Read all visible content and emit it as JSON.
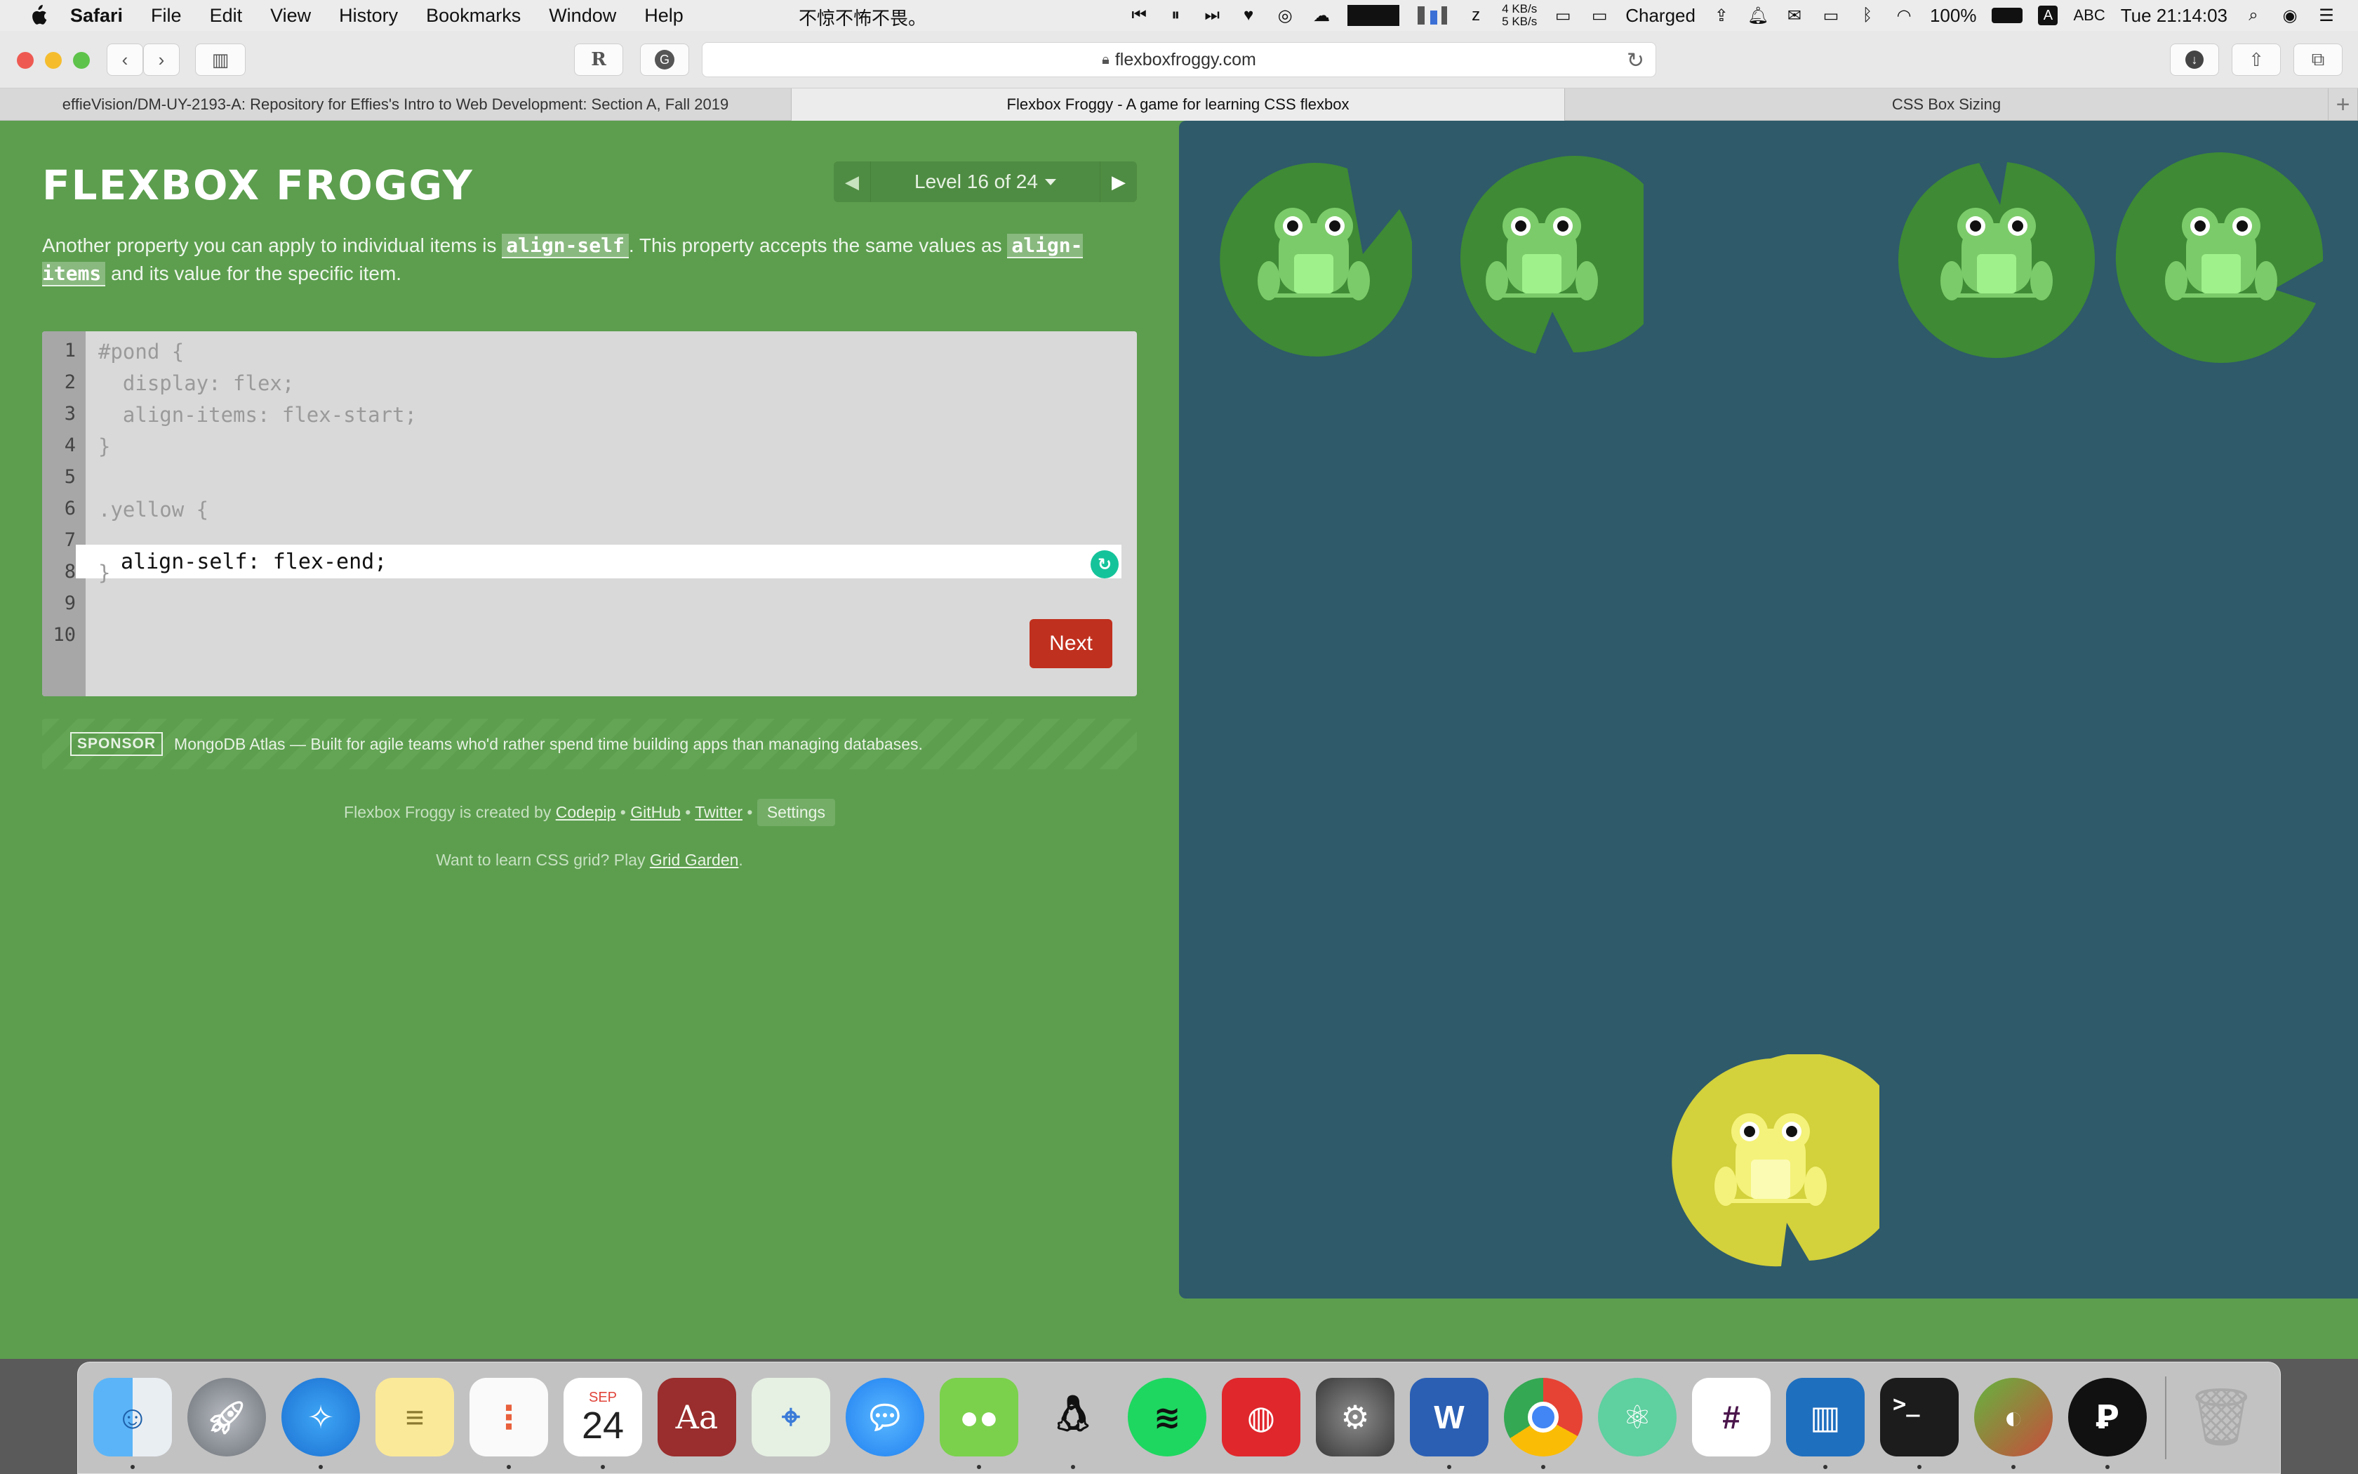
{
  "menubar": {
    "app_name": "Safari",
    "items": [
      "File",
      "Edit",
      "View",
      "History",
      "Bookmarks",
      "Window",
      "Help"
    ],
    "chinese_text": "不惊不怖不畏。",
    "status": {
      "net_up": "4 KB/s",
      "net_down": "5 KB/s",
      "battery_state": "Charged",
      "battery_percent": "100%",
      "input_method": "ABC",
      "clock": "Tue 21:14:03"
    }
  },
  "browser": {
    "url": "flexboxfroggy.com",
    "tabs": [
      {
        "title": "effieVision/DM-UY-2193-A: Repository for Effies's Intro to Web Development: Section A, Fall 2019"
      },
      {
        "title": "Flexbox Froggy - A game for learning CSS flexbox"
      },
      {
        "title": "CSS Box Sizing"
      }
    ]
  },
  "game": {
    "title": "FLEXBOX FROGGY",
    "level_label": "Level 16 of 24",
    "instructions": {
      "part1": "Another property you can apply to individual items is ",
      "code1": "align-self",
      "part2": ". This property accepts the same values as ",
      "code2": "align-items",
      "part3": " and its value for the specific item."
    },
    "code_lines": [
      "#pond {",
      "  display: flex;",
      "  align-items: flex-start;",
      "}",
      "",
      ".yellow {",
      "",
      "}",
      "",
      ""
    ],
    "line_numbers": [
      "1",
      "2",
      "3",
      "4",
      "5",
      "6",
      "7",
      "8",
      "9",
      "10"
    ],
    "answer_value": "align-self: flex-end;",
    "next_label": "Next",
    "sponsor": {
      "badge": "SPONSOR",
      "text": "MongoDB Atlas — Built for agile teams who'd rather spend time building apps than managing databases."
    },
    "credits": {
      "prefix": "Flexbox Froggy is created by ",
      "codepip": "Codepip",
      "github": "GitHub",
      "twitter": "Twitter",
      "settings": "Settings",
      "sep": " • "
    },
    "grid_garden": {
      "prefix": "Want to learn CSS grid? Play ",
      "link": "Grid Garden",
      "suffix": "."
    },
    "colors": {
      "background": "#5c9e4e",
      "pond": "#2e5a6a",
      "green_pad": "#3e8a35",
      "green_frog": "#7ccb6a",
      "yellow_pad": "#d3d13c",
      "yellow_frog": "#f4f27a",
      "next_button": "#c0301e"
    }
  },
  "dock": {
    "apps": [
      "Finder",
      "Launchpad",
      "Safari",
      "Notes",
      "Reminders",
      "Calendar",
      "Dictionary",
      "Maps",
      "Messages",
      "WeChat",
      "QQ",
      "Spotify",
      "NetEase Music",
      "System Preferences",
      "Word",
      "Chrome",
      "Atom",
      "Slack",
      "Trello",
      "Terminal",
      "Sublime Merge",
      "Trash"
    ],
    "calendar_month": "SEP",
    "calendar_day": "24"
  }
}
